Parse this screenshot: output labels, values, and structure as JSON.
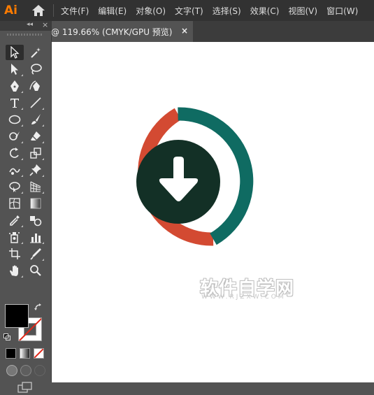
{
  "app": {
    "logo": "Ai"
  },
  "menu": [
    "文件(F)",
    "编辑(E)",
    "对象(O)",
    "文字(T)",
    "选择(S)",
    "效果(C)",
    "视图(V)",
    "窗口(W)"
  ],
  "document_tab": {
    "title": "@ 119.66% (CMYK/GPU 预览)",
    "close": "×"
  },
  "toolbar": {
    "collapse": "◂◂",
    "close": "×",
    "tools": [
      "selection-tool",
      "magic-wand-tool",
      "direct-selection-tool",
      "lasso-tool",
      "pen-tool",
      "curvature-tool",
      "type-tool",
      "line-segment-tool",
      "ellipse-tool",
      "paintbrush-tool",
      "shaper-tool",
      "eraser-tool",
      "rotate-tool",
      "scale-tool",
      "puppet-warp-tool",
      "pin-tool",
      "shape-builder-tool",
      "perspective-grid-tool",
      "mesh-tool",
      "gradient-tool",
      "eyedropper-tool",
      "blend-tool",
      "symbol-sprayer-tool",
      "column-graph-tool",
      "artboard-tool",
      "slice-tool",
      "hand-tool",
      "zoom-tool"
    ]
  },
  "colors": {
    "ring_left": "#d34a32",
    "ring_right": "#0f6b62",
    "inner_circle": "#133026",
    "arrow": "#ffffff",
    "fill": "#000000",
    "stroke": "#ffffff"
  },
  "watermark": {
    "text": "软件自学网",
    "url": "WWW.RJZXW.COM"
  }
}
